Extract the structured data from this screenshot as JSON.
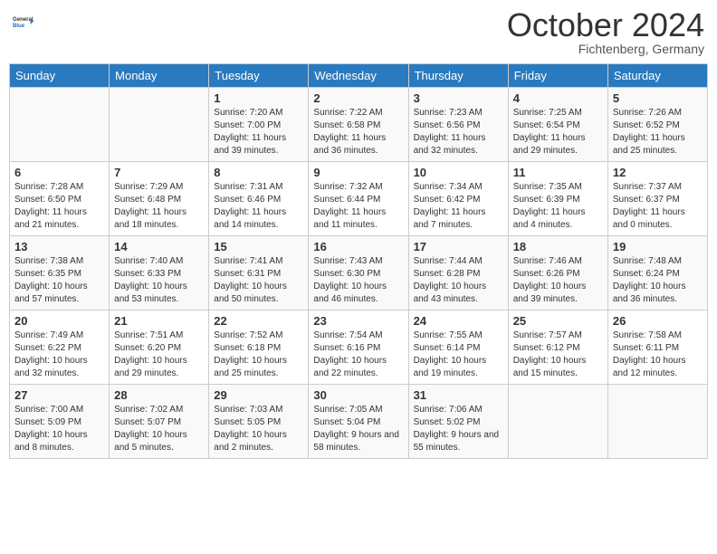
{
  "header": {
    "logo_line1": "General",
    "logo_line2": "Blue",
    "month": "October 2024",
    "location": "Fichtenberg, Germany"
  },
  "weekdays": [
    "Sunday",
    "Monday",
    "Tuesday",
    "Wednesday",
    "Thursday",
    "Friday",
    "Saturday"
  ],
  "weeks": [
    [
      {
        "day": "",
        "info": ""
      },
      {
        "day": "",
        "info": ""
      },
      {
        "day": "1",
        "info": "Sunrise: 7:20 AM\nSunset: 7:00 PM\nDaylight: 11 hours and 39 minutes."
      },
      {
        "day": "2",
        "info": "Sunrise: 7:22 AM\nSunset: 6:58 PM\nDaylight: 11 hours and 36 minutes."
      },
      {
        "day": "3",
        "info": "Sunrise: 7:23 AM\nSunset: 6:56 PM\nDaylight: 11 hours and 32 minutes."
      },
      {
        "day": "4",
        "info": "Sunrise: 7:25 AM\nSunset: 6:54 PM\nDaylight: 11 hours and 29 minutes."
      },
      {
        "day": "5",
        "info": "Sunrise: 7:26 AM\nSunset: 6:52 PM\nDaylight: 11 hours and 25 minutes."
      }
    ],
    [
      {
        "day": "6",
        "info": "Sunrise: 7:28 AM\nSunset: 6:50 PM\nDaylight: 11 hours and 21 minutes."
      },
      {
        "day": "7",
        "info": "Sunrise: 7:29 AM\nSunset: 6:48 PM\nDaylight: 11 hours and 18 minutes."
      },
      {
        "day": "8",
        "info": "Sunrise: 7:31 AM\nSunset: 6:46 PM\nDaylight: 11 hours and 14 minutes."
      },
      {
        "day": "9",
        "info": "Sunrise: 7:32 AM\nSunset: 6:44 PM\nDaylight: 11 hours and 11 minutes."
      },
      {
        "day": "10",
        "info": "Sunrise: 7:34 AM\nSunset: 6:42 PM\nDaylight: 11 hours and 7 minutes."
      },
      {
        "day": "11",
        "info": "Sunrise: 7:35 AM\nSunset: 6:39 PM\nDaylight: 11 hours and 4 minutes."
      },
      {
        "day": "12",
        "info": "Sunrise: 7:37 AM\nSunset: 6:37 PM\nDaylight: 11 hours and 0 minutes."
      }
    ],
    [
      {
        "day": "13",
        "info": "Sunrise: 7:38 AM\nSunset: 6:35 PM\nDaylight: 10 hours and 57 minutes."
      },
      {
        "day": "14",
        "info": "Sunrise: 7:40 AM\nSunset: 6:33 PM\nDaylight: 10 hours and 53 minutes."
      },
      {
        "day": "15",
        "info": "Sunrise: 7:41 AM\nSunset: 6:31 PM\nDaylight: 10 hours and 50 minutes."
      },
      {
        "day": "16",
        "info": "Sunrise: 7:43 AM\nSunset: 6:30 PM\nDaylight: 10 hours and 46 minutes."
      },
      {
        "day": "17",
        "info": "Sunrise: 7:44 AM\nSunset: 6:28 PM\nDaylight: 10 hours and 43 minutes."
      },
      {
        "day": "18",
        "info": "Sunrise: 7:46 AM\nSunset: 6:26 PM\nDaylight: 10 hours and 39 minutes."
      },
      {
        "day": "19",
        "info": "Sunrise: 7:48 AM\nSunset: 6:24 PM\nDaylight: 10 hours and 36 minutes."
      }
    ],
    [
      {
        "day": "20",
        "info": "Sunrise: 7:49 AM\nSunset: 6:22 PM\nDaylight: 10 hours and 32 minutes."
      },
      {
        "day": "21",
        "info": "Sunrise: 7:51 AM\nSunset: 6:20 PM\nDaylight: 10 hours and 29 minutes."
      },
      {
        "day": "22",
        "info": "Sunrise: 7:52 AM\nSunset: 6:18 PM\nDaylight: 10 hours and 25 minutes."
      },
      {
        "day": "23",
        "info": "Sunrise: 7:54 AM\nSunset: 6:16 PM\nDaylight: 10 hours and 22 minutes."
      },
      {
        "day": "24",
        "info": "Sunrise: 7:55 AM\nSunset: 6:14 PM\nDaylight: 10 hours and 19 minutes."
      },
      {
        "day": "25",
        "info": "Sunrise: 7:57 AM\nSunset: 6:12 PM\nDaylight: 10 hours and 15 minutes."
      },
      {
        "day": "26",
        "info": "Sunrise: 7:58 AM\nSunset: 6:11 PM\nDaylight: 10 hours and 12 minutes."
      }
    ],
    [
      {
        "day": "27",
        "info": "Sunrise: 7:00 AM\nSunset: 5:09 PM\nDaylight: 10 hours and 8 minutes."
      },
      {
        "day": "28",
        "info": "Sunrise: 7:02 AM\nSunset: 5:07 PM\nDaylight: 10 hours and 5 minutes."
      },
      {
        "day": "29",
        "info": "Sunrise: 7:03 AM\nSunset: 5:05 PM\nDaylight: 10 hours and 2 minutes."
      },
      {
        "day": "30",
        "info": "Sunrise: 7:05 AM\nSunset: 5:04 PM\nDaylight: 9 hours and 58 minutes."
      },
      {
        "day": "31",
        "info": "Sunrise: 7:06 AM\nSunset: 5:02 PM\nDaylight: 9 hours and 55 minutes."
      },
      {
        "day": "",
        "info": ""
      },
      {
        "day": "",
        "info": ""
      }
    ]
  ]
}
